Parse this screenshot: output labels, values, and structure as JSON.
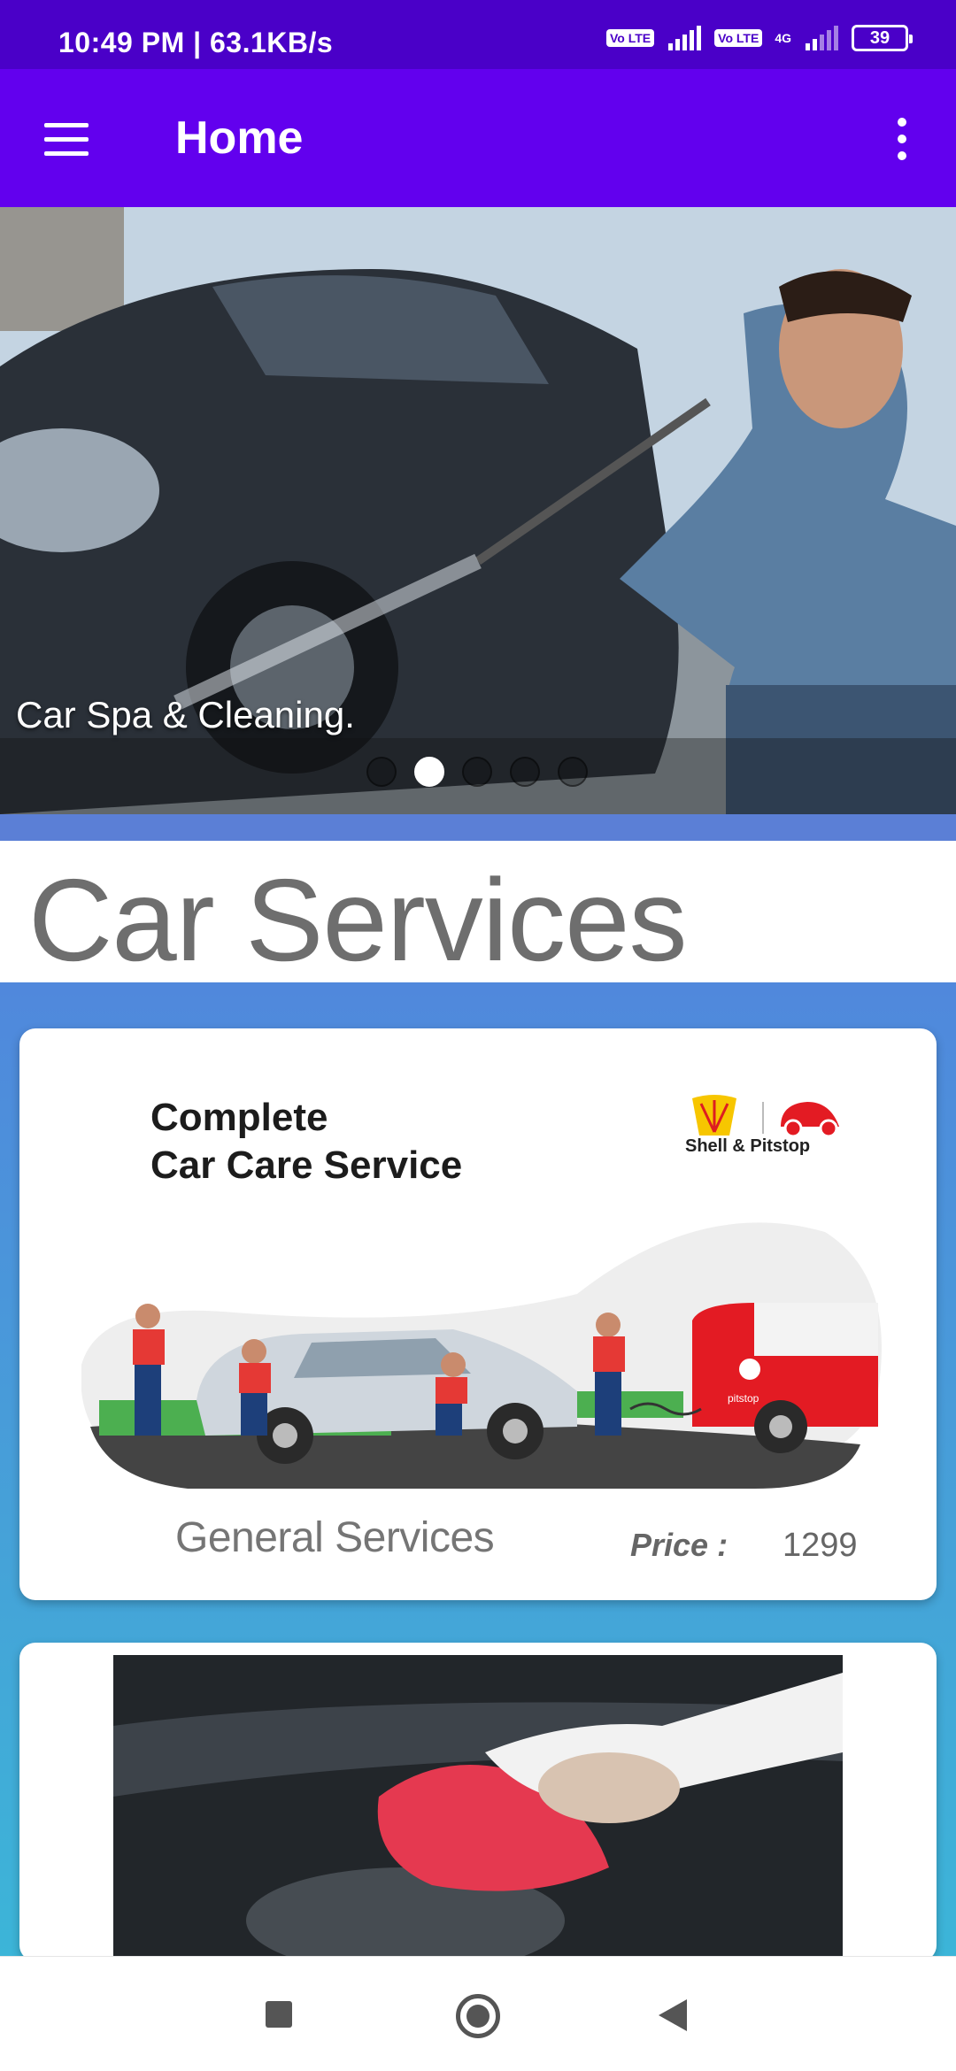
{
  "status_bar": {
    "time": "10:49 PM | 63.1KB/s",
    "sim1_label": "Vo LTE",
    "sim2_label": "Vo LTE",
    "network_type": "4G",
    "battery": "39"
  },
  "app_bar": {
    "title": "Home",
    "menu_icon": "hamburger-menu-icon",
    "overflow_icon": "more-vert-icon"
  },
  "carousel": {
    "caption": "Car Spa & Cleaning.",
    "slide_count": 5,
    "active_index": 1
  },
  "section": {
    "title": "Car Services"
  },
  "services": [
    {
      "promo_line1": "Complete",
      "promo_line2": "Car Care Service",
      "brand_text": "Shell & Pitstop",
      "van_label": "pitstop",
      "name": "General Services",
      "price_label": "Price :",
      "price_value": "1299"
    }
  ],
  "colors": {
    "status_bar": "#4a00c8",
    "app_bar": "#6200ee",
    "section_title": "#6e6e6e",
    "services_background": "#5088dc"
  }
}
